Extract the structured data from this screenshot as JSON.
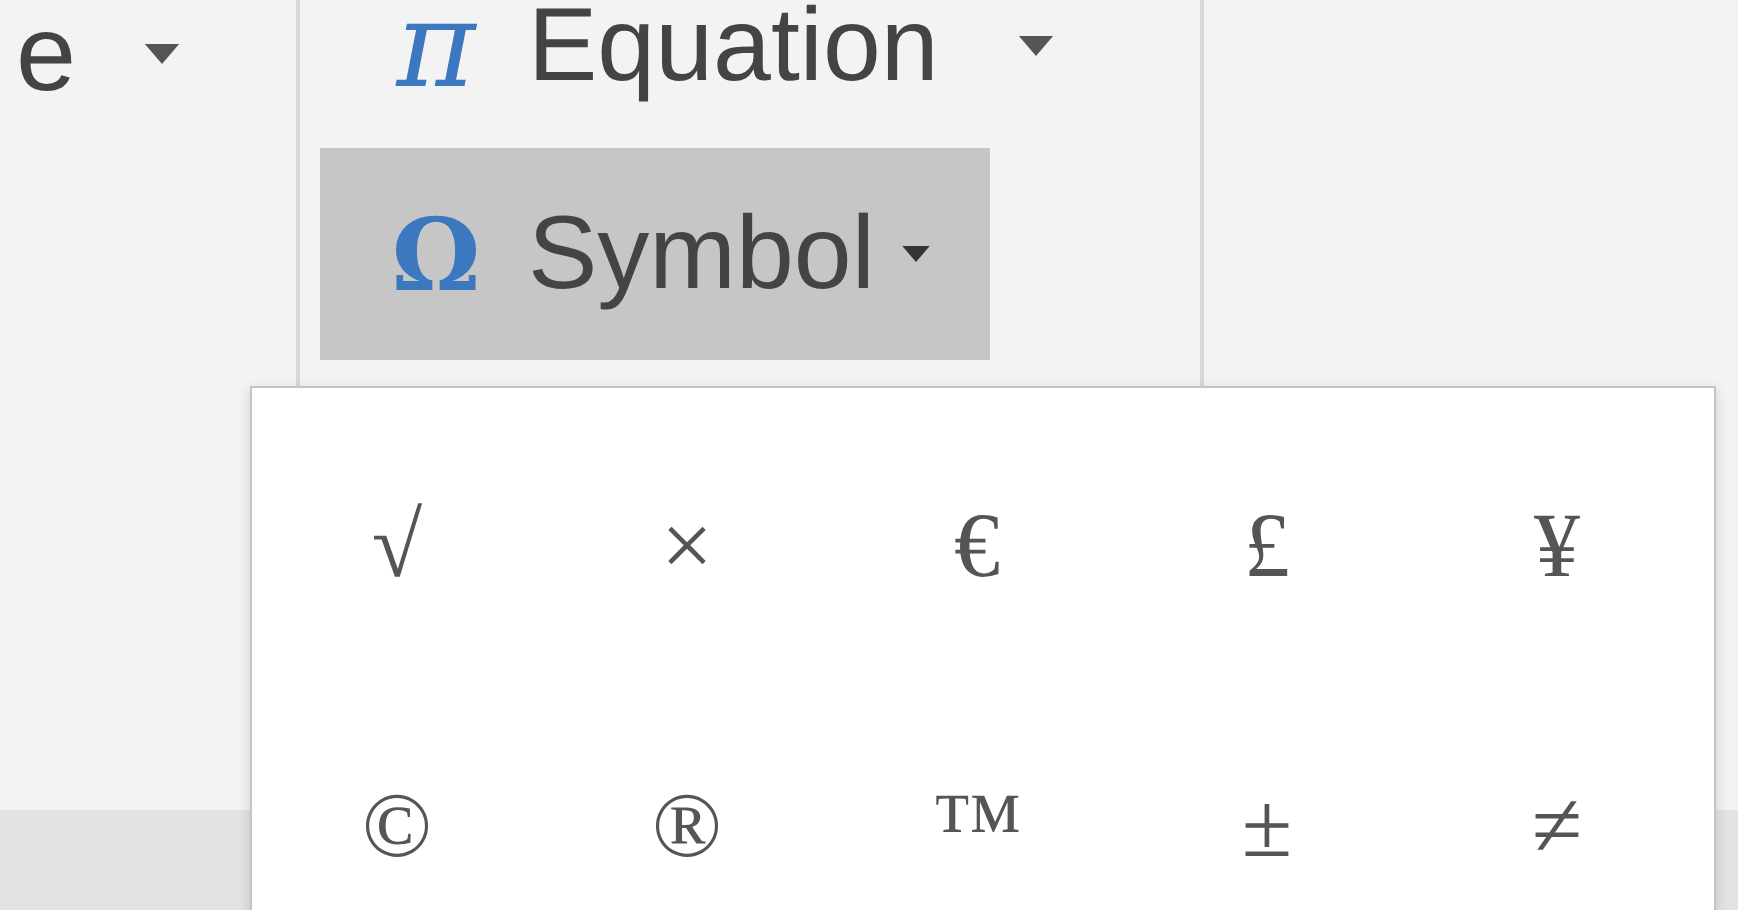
{
  "ribbon": {
    "left_button": {
      "label": "e"
    },
    "equation_button": {
      "icon": "π",
      "label": "Equation"
    },
    "symbol_button": {
      "icon": "Ω",
      "label": "Symbol",
      "expanded": true
    }
  },
  "symbol_menu": {
    "symbols": [
      {
        "symbol": "√"
      },
      {
        "symbol": "×"
      },
      {
        "symbol": "€"
      },
      {
        "symbol": "£"
      },
      {
        "symbol": "¥"
      },
      {
        "symbol": "©"
      },
      {
        "symbol": "®"
      },
      {
        "symbol": "™"
      },
      {
        "symbol": "±"
      },
      {
        "symbol": "≠"
      }
    ]
  }
}
